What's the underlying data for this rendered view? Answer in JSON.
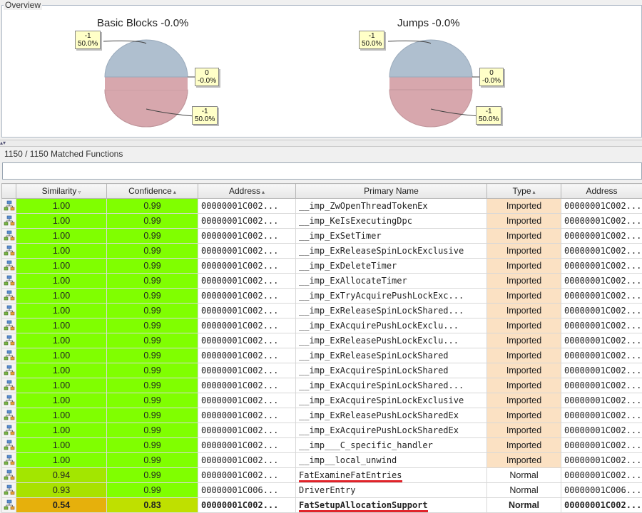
{
  "overview": {
    "title": "Overview",
    "pies": [
      {
        "title": "Basic Blocks -0.0%",
        "labels": [
          {
            "value": "-1",
            "pct": "50.0%"
          },
          {
            "value": "0",
            "pct": "-0.0%"
          },
          {
            "value": "-1",
            "pct": "50.0%"
          }
        ]
      },
      {
        "title": "Jumps -0.0%",
        "labels": [
          {
            "value": "-1",
            "pct": "50.0%"
          },
          {
            "value": "0",
            "pct": "-0.0%"
          },
          {
            "value": "-1",
            "pct": "50.0%"
          }
        ]
      }
    ],
    "colors": {
      "top": "#afbfcf",
      "bottom": "#d7a7ad"
    }
  },
  "matched": {
    "label": "1150 / 1150 Matched Functions",
    "filter_value": ""
  },
  "table": {
    "headers": [
      "Similarity",
      "Confidence",
      "Address",
      "Primary Name",
      "Type",
      "Address"
    ],
    "sort_marks": [
      "▿",
      "▴",
      "▴",
      "",
      "▴",
      ""
    ],
    "rows": [
      {
        "sim": "1.00",
        "conf": "0.99",
        "addr": "00000001C002...",
        "name": "__imp_ZwOpenThreadTokenEx",
        "type": "Imported",
        "addr2": "00000001C002..."
      },
      {
        "sim": "1.00",
        "conf": "0.99",
        "addr": "00000001C002...",
        "name": "__imp_KeIsExecutingDpc",
        "type": "Imported",
        "addr2": "00000001C002..."
      },
      {
        "sim": "1.00",
        "conf": "0.99",
        "addr": "00000001C002...",
        "name": "__imp_ExSetTimer",
        "type": "Imported",
        "addr2": "00000001C002..."
      },
      {
        "sim": "1.00",
        "conf": "0.99",
        "addr": "00000001C002...",
        "name": "__imp_ExReleaseSpinLockExclusive",
        "type": "Imported",
        "addr2": "00000001C002..."
      },
      {
        "sim": "1.00",
        "conf": "0.99",
        "addr": "00000001C002...",
        "name": "__imp_ExDeleteTimer",
        "type": "Imported",
        "addr2": "00000001C002..."
      },
      {
        "sim": "1.00",
        "conf": "0.99",
        "addr": "00000001C002...",
        "name": "__imp_ExAllocateTimer",
        "type": "Imported",
        "addr2": "00000001C002..."
      },
      {
        "sim": "1.00",
        "conf": "0.99",
        "addr": "00000001C002...",
        "name": "__imp_ExTryAcquirePushLockExc...",
        "type": "Imported",
        "addr2": "00000001C002..."
      },
      {
        "sim": "1.00",
        "conf": "0.99",
        "addr": "00000001C002...",
        "name": "__imp_ExReleaseSpinLockShared...",
        "type": "Imported",
        "addr2": "00000001C002..."
      },
      {
        "sim": "1.00",
        "conf": "0.99",
        "addr": "00000001C002...",
        "name": "__imp_ExAcquirePushLockExclu...",
        "type": "Imported",
        "addr2": "00000001C002..."
      },
      {
        "sim": "1.00",
        "conf": "0.99",
        "addr": "00000001C002...",
        "name": "__imp_ExReleasePushLockExclu...",
        "type": "Imported",
        "addr2": "00000001C002..."
      },
      {
        "sim": "1.00",
        "conf": "0.99",
        "addr": "00000001C002...",
        "name": "__imp_ExReleaseSpinLockShared",
        "type": "Imported",
        "addr2": "00000001C002..."
      },
      {
        "sim": "1.00",
        "conf": "0.99",
        "addr": "00000001C002...",
        "name": "__imp_ExAcquireSpinLockShared",
        "type": "Imported",
        "addr2": "00000001C002..."
      },
      {
        "sim": "1.00",
        "conf": "0.99",
        "addr": "00000001C002...",
        "name": "__imp_ExAcquireSpinLockShared...",
        "type": "Imported",
        "addr2": "00000001C002..."
      },
      {
        "sim": "1.00",
        "conf": "0.99",
        "addr": "00000001C002...",
        "name": "__imp_ExAcquireSpinLockExclusive",
        "type": "Imported",
        "addr2": "00000001C002..."
      },
      {
        "sim": "1.00",
        "conf": "0.99",
        "addr": "00000001C002...",
        "name": "__imp_ExReleasePushLockSharedEx",
        "type": "Imported",
        "addr2": "00000001C002..."
      },
      {
        "sim": "1.00",
        "conf": "0.99",
        "addr": "00000001C002...",
        "name": "__imp_ExAcquirePushLockSharedEx",
        "type": "Imported",
        "addr2": "00000001C002..."
      },
      {
        "sim": "1.00",
        "conf": "0.99",
        "addr": "00000001C002...",
        "name": "__imp___C_specific_handler",
        "type": "Imported",
        "addr2": "00000001C002..."
      },
      {
        "sim": "1.00",
        "conf": "0.99",
        "addr": "00000001C002...",
        "name": "__imp__local_unwind",
        "type": "Imported",
        "addr2": "00000001C002..."
      },
      {
        "sim": "0.94",
        "conf": "0.99",
        "addr": "00000001C002...",
        "name": "FatExamineFatEntries",
        "type": "Normal",
        "addr2": "00000001C002...",
        "underline": true
      },
      {
        "sim": "0.93",
        "conf": "0.99",
        "addr": "00000001C006...",
        "name": "DriverEntry",
        "type": "Normal",
        "addr2": "00000001C006..."
      },
      {
        "sim": "0.54",
        "conf": "0.83",
        "addr": "00000001C002...",
        "name": "FatSetupAllocationSupport",
        "type": "Normal",
        "addr2": "00000001C002...",
        "underline": true,
        "bold": true
      }
    ],
    "colors": {
      "green_full": "#80ff00",
      "green_094": "#a3e600",
      "green_093": "#a8e200",
      "orange_054": "#e6b00c",
      "conf_083": "#bfe000",
      "imported_bg": "#fbe1c3"
    }
  }
}
